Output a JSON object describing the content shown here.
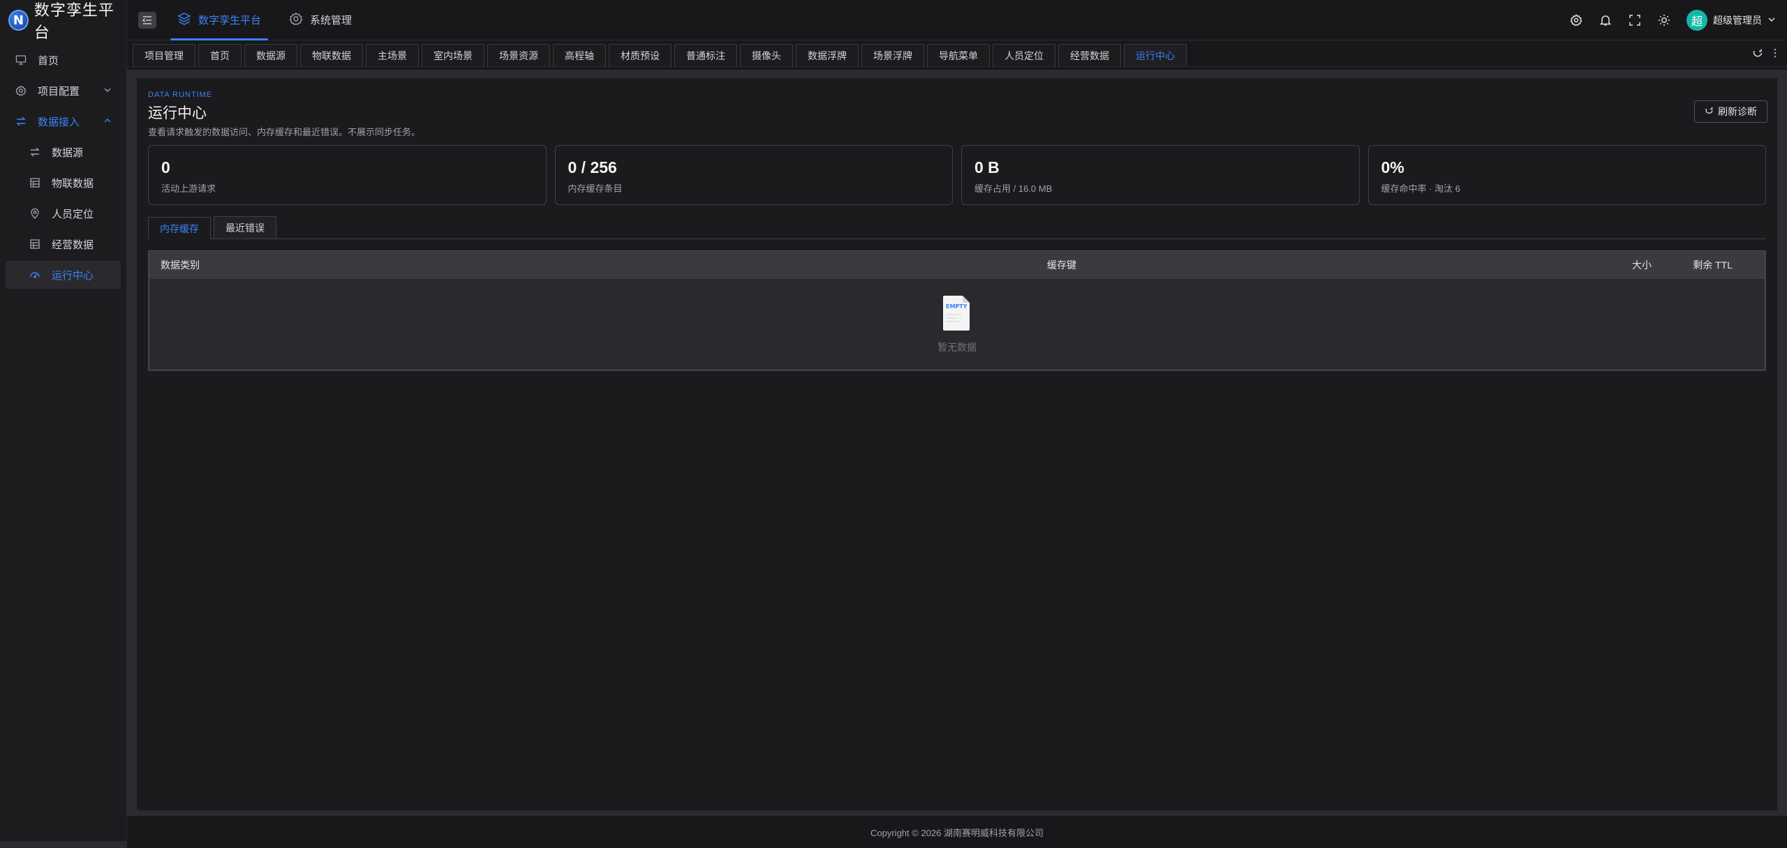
{
  "app": {
    "title": "数字孪生平台"
  },
  "sidebar": {
    "items": [
      {
        "label": "首页",
        "icon": "monitor-icon"
      },
      {
        "label": "项目配置",
        "icon": "gear-icon"
      },
      {
        "label": "数据接入",
        "icon": "swap-icon"
      },
      {
        "label": "数据源",
        "icon": "swap-icon"
      },
      {
        "label": "物联数据",
        "icon": "table-icon"
      },
      {
        "label": "人员定位",
        "icon": "location-pin-icon"
      },
      {
        "label": "经营数据",
        "icon": "table-icon"
      },
      {
        "label": "运行中心",
        "icon": "dashboard-gauge-icon"
      }
    ]
  },
  "header": {
    "nav": [
      {
        "label": "数字孪生平台",
        "icon": "layers-icon"
      },
      {
        "label": "系统管理",
        "icon": "gear-icon"
      }
    ],
    "user": {
      "avatar": "超",
      "name": "超级管理员"
    }
  },
  "tabs": [
    "项目管理",
    "首页",
    "数据源",
    "物联数据",
    "主场景",
    "室内场景",
    "场景资源",
    "高程轴",
    "材质预设",
    "普通标注",
    "摄像头",
    "数据浮牌",
    "场景浮牌",
    "导航菜单",
    "人员定位",
    "经营数据",
    "运行中心"
  ],
  "active_tab": "运行中心",
  "page": {
    "kicker": "DATA RUNTIME",
    "title": "运行中心",
    "description": "查看请求触发的数据访问、内存缓存和最近错误。不展示同步任务。",
    "refresh_label": "刷新诊断",
    "stats": [
      {
        "value": "0",
        "label": "活动上游请求"
      },
      {
        "value": "0 / 256",
        "label": "内存缓存条目"
      },
      {
        "value": "0 B",
        "label": "缓存占用 / 16.0 MB"
      },
      {
        "value": "0%",
        "label": "缓存命中率 · 淘汰 6"
      }
    ],
    "inner_tabs": [
      "内存缓存",
      "最近错误"
    ],
    "table": {
      "columns": [
        "数据类别",
        "缓存键",
        "大小",
        "剩余 TTL"
      ],
      "rows": [],
      "empty_text": "暂无数据",
      "empty_icon_text": "EMPTY"
    }
  },
  "footer": {
    "copyright": "Copyright © 2026 湖南赛明威科技有限公司"
  },
  "colors": {
    "accent": "#3b82f6",
    "avatar": "#14b8a6",
    "background": "#18181b"
  }
}
